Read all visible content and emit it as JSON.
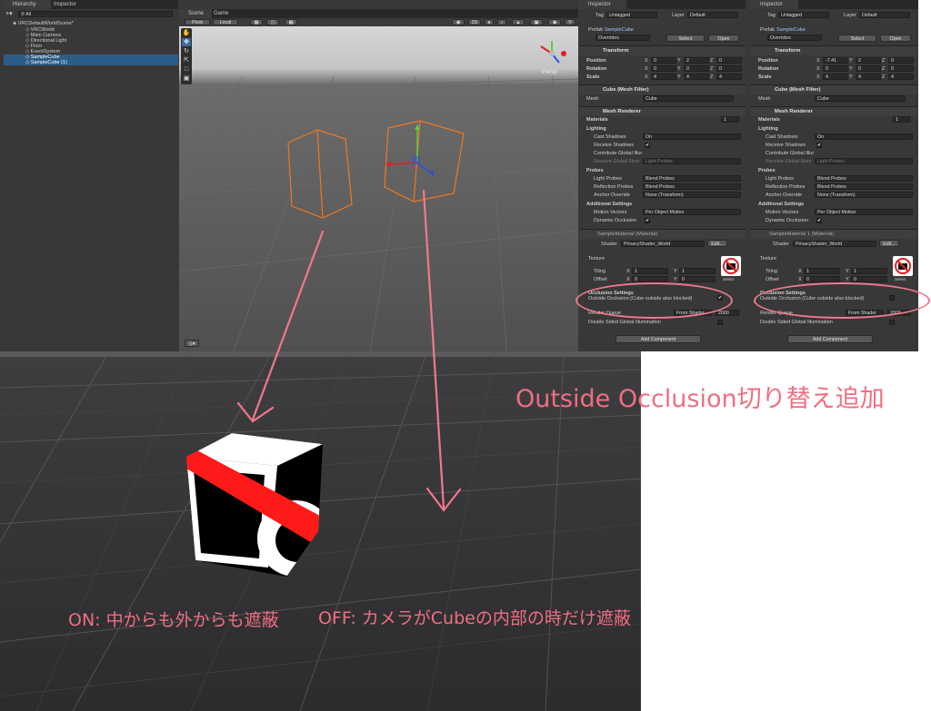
{
  "hierarchy": {
    "tabs": [
      "Hierarchy",
      "Inspector"
    ],
    "search_placeholder": "All",
    "scene_name": "VRCDefaultWorldScene*",
    "items": [
      {
        "label": "VRCWorld",
        "selected": false
      },
      {
        "label": "Main Camera",
        "selected": false
      },
      {
        "label": "Directional Light",
        "selected": false
      },
      {
        "label": "Floor",
        "selected": false
      },
      {
        "label": "EventSystem",
        "selected": false
      },
      {
        "label": "SampleCube",
        "selected": true
      },
      {
        "label": "SampleCube (1)",
        "selected": true
      }
    ]
  },
  "scene": {
    "tabs": [
      "Scene",
      "Game"
    ],
    "pivot": "Pivot",
    "local": "Local",
    "mode_2d": "2D",
    "persp_label": "‹Persp"
  },
  "inspectors": [
    {
      "tab": "Inspector",
      "tag_label": "Tag",
      "tag_value": "Untagged",
      "layer_label": "Layer",
      "layer_value": "Default",
      "prefab_label": "Prefab",
      "prefab_value": "SampleCube",
      "overrides": "Overrides",
      "select_btn": "Select",
      "open_btn": "Open",
      "transform_title": "Transform",
      "position_label": "Position",
      "position": [
        "0",
        "2",
        "0"
      ],
      "rotation_label": "Rotation",
      "rotation": [
        "0",
        "0",
        "0"
      ],
      "scale_label": "Scale",
      "scale": [
        "4",
        "4",
        "4"
      ],
      "mesh_filter_title": "Cube (Mesh Filter)",
      "mesh_label": "Mesh",
      "mesh_value": "Cube",
      "mesh_renderer_title": "Mesh Renderer",
      "materials_label": "Materials",
      "materials_count": "1",
      "lighting_label": "Lighting",
      "cast_shadows_label": "Cast Shadows",
      "cast_shadows_value": "On",
      "receive_shadows_label": "Receive Shadows",
      "contribute_gi_label": "Contribute Global Illur",
      "receive_gi_label": "Receive Global Illum",
      "receive_gi_value": "Light Probes",
      "probes_label": "Probes",
      "light_probes_label": "Light Probes",
      "light_probes_value": "Blend Probes",
      "reflection_probes_label": "Reflection Probes",
      "reflection_probes_value": "Blend Probes",
      "anchor_override_label": "Anchor Override",
      "anchor_override_value": "None (Transform)",
      "additional_label": "Additional Settings",
      "motion_vectors_label": "Motion Vectors",
      "motion_vectors_value": "Per Object Motion",
      "dynamic_occlusion_label": "Dynamic Occlusion",
      "material_name": "SampleMaterial (Material)",
      "shader_label": "Shader",
      "shader_value": "PrivacyShader_World",
      "edit_btn": "Edit...",
      "texture_label": "Texture",
      "tiling_label": "Tiling",
      "tiling": [
        "1",
        "1"
      ],
      "offset_label": "Offset",
      "offset": [
        "0",
        "0"
      ],
      "select_small": "Select",
      "occlusion_settings_label": "Occlusion Settings",
      "outside_occlusion_label": "Outside Occlusion (Cube outside also blocked)",
      "outside_occlusion_checked": true,
      "render_queue_label": "Render Queue",
      "render_queue_value": "From Shader",
      "render_queue_number": "2000",
      "double_sided_gi_label": "Double Sided Global Illumination",
      "add_component": "Add Component"
    },
    {
      "tab": "Inspector",
      "tag_label": "Tag",
      "tag_value": "Untagged",
      "layer_label": "Layer",
      "layer_value": "Default",
      "prefab_label": "Prefab",
      "prefab_value": "SampleCube",
      "overrides": "Overrides",
      "select_btn": "Select",
      "open_btn": "Open",
      "transform_title": "Transform",
      "position_label": "Position",
      "position": [
        "-7.41",
        "2",
        "0"
      ],
      "rotation_label": "Rotation",
      "rotation": [
        "0",
        "0",
        "0"
      ],
      "scale_label": "Scale",
      "scale": [
        "4",
        "4",
        "4"
      ],
      "mesh_filter_title": "Cube (Mesh Filter)",
      "mesh_label": "Mesh",
      "mesh_value": "Cube",
      "mesh_renderer_title": "Mesh Renderer",
      "materials_label": "Materials",
      "materials_count": "1",
      "lighting_label": "Lighting",
      "cast_shadows_label": "Cast Shadows",
      "cast_shadows_value": "On",
      "receive_shadows_label": "Receive Shadows",
      "contribute_gi_label": "Contribute Global Illur",
      "receive_gi_label": "Receive Global Illum",
      "receive_gi_value": "Light Probes",
      "probes_label": "Probes",
      "light_probes_label": "Light Probes",
      "light_probes_value": "Blend Probes",
      "reflection_probes_label": "Reflection Probes",
      "reflection_probes_value": "Blend Probes",
      "anchor_override_label": "Anchor Override",
      "anchor_override_value": "None (Transform)",
      "additional_label": "Additional Settings",
      "motion_vectors_label": "Motion Vectors",
      "motion_vectors_value": "Per Object Motion",
      "dynamic_occlusion_label": "Dynamic Occlusion",
      "material_name": "SampleMaterial 1 (Material)",
      "shader_label": "Shader",
      "shader_value": "PrivacyShader_World",
      "edit_btn": "Edit...",
      "texture_label": "Texture",
      "tiling_label": "Tiling",
      "tiling": [
        "1",
        "1"
      ],
      "offset_label": "Offset",
      "offset": [
        "0",
        "0"
      ],
      "select_small": "Select",
      "occlusion_settings_label": "Occlusion Settings",
      "outside_occlusion_label": "Outside Occlusion (Cube outside also blocked)",
      "outside_occlusion_checked": false,
      "render_queue_label": "Render Queue",
      "render_queue_value": "From Shader",
      "render_queue_number": "2000",
      "double_sided_gi_label": "Double Sided Global Illumination",
      "add_component": "Add Component"
    }
  ],
  "annotations": {
    "title": "Outside Occlusion切り替え追加",
    "on_label": "ON: 中からも外からも遮蔽",
    "off_label": "OFF: カメラがCubeの内部の時だけ遮蔽",
    "color": "#f06e82"
  },
  "colors": {
    "editor_bg": "#383838",
    "selection": "#2c5d87",
    "cube_outline": "#f07820",
    "cube_red": "#ff1a1a"
  }
}
